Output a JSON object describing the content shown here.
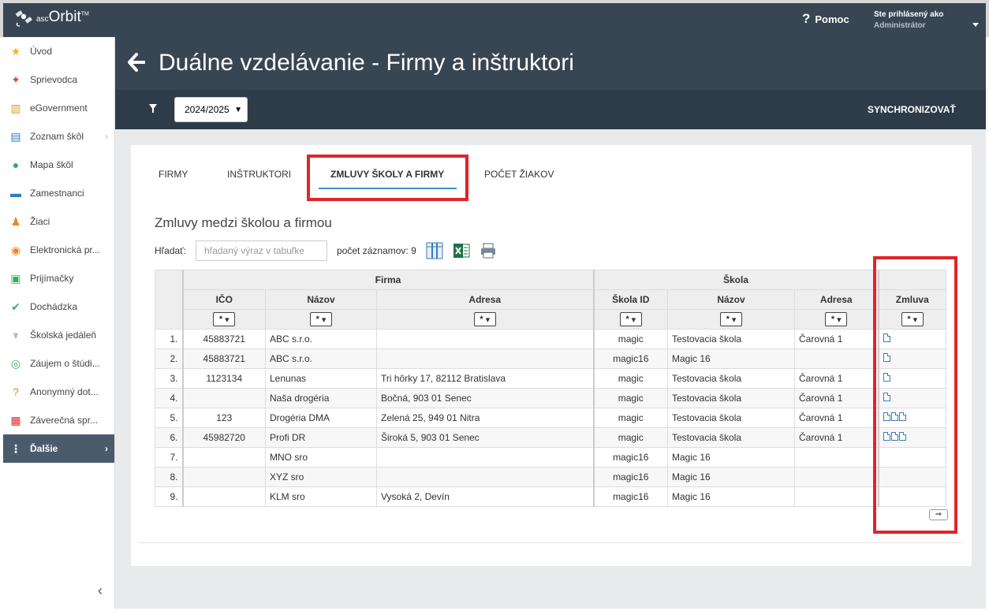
{
  "app": {
    "logo_text": "Orbit",
    "logo_small": "asc",
    "logo_tm": "TM",
    "help_label": "Pomoc",
    "user_line1": "Ste prihlásený ako",
    "user_line2": "Administrátor"
  },
  "sidebar": {
    "items": [
      {
        "label": "Úvod",
        "icon": "star-icon",
        "color": "#f2b41c"
      },
      {
        "label": "Sprievodca",
        "icon": "wand-icon",
        "color": "#e04a2a"
      },
      {
        "label": "eGovernment",
        "icon": "bank-icon",
        "color": "#d8a21c"
      },
      {
        "label": "Zoznam škôl",
        "icon": "book-icon",
        "color": "#2e7fc2"
      },
      {
        "label": "Mapa škôl",
        "icon": "map-pin-icon",
        "color": "#2fb05a"
      },
      {
        "label": "Zamestnanci",
        "icon": "briefcase-icon",
        "color": "#2e7fc2"
      },
      {
        "label": "Žiaci",
        "icon": "student-icon",
        "color": "#e8862a"
      },
      {
        "label": "Elektronická pr...",
        "icon": "application-icon",
        "color": "#e8862a"
      },
      {
        "label": "Prijímačky",
        "icon": "badge-icon",
        "color": "#2fb05a"
      },
      {
        "label": "Dochádzka",
        "icon": "check-circle-icon",
        "color": "#2fb08a"
      },
      {
        "label": "Školská jedáleň",
        "icon": "cup-icon",
        "color": "#7b3a8c"
      },
      {
        "label": "Záujem o štúdi...",
        "icon": "compass-icon",
        "color": "#2fb05a"
      },
      {
        "label": "Anonymný dot...",
        "icon": "question-icon",
        "color": "#e8862a"
      },
      {
        "label": "Záverečná spr...",
        "icon": "clipboard-icon",
        "color": "#e0242b"
      },
      {
        "label": "Ďalšie",
        "icon": "more-icon",
        "color": "#ffffff"
      }
    ]
  },
  "header": {
    "title": "Duálne vzdelávanie - Firmy a inštruktori",
    "year": "2024/2025",
    "sync_label": "SYNCHRONIZOVAŤ"
  },
  "tabs": [
    {
      "label": "FIRMY"
    },
    {
      "label": "INŠTRUKTORI"
    },
    {
      "label": "ZMLUVY ŠKOLY A FIRMY"
    },
    {
      "label": "POČET ŽIAKOV"
    }
  ],
  "content": {
    "section_title": "Zmluvy medzi školou a firmou",
    "search_label": "Hľadať:",
    "search_placeholder": "hľadaný výraz v tabuľke",
    "count_label": "počet záznamov: 9"
  },
  "table": {
    "group_firma": "Firma",
    "group_skola": "Škola",
    "columns": [
      "IČO",
      "Názov",
      "Adresa",
      "Škola ID",
      "Názov",
      "Adresa",
      "Zmluva"
    ],
    "filter_value": "*",
    "rows": [
      {
        "n": "1.",
        "ico": "45883721",
        "firma": "ABC s.r.o.",
        "adresa": "",
        "skola_id": "magic",
        "skola": "Testovacia škola",
        "skola_adresa": "Čarovná 1",
        "docs": 1
      },
      {
        "n": "2.",
        "ico": "45883721",
        "firma": "ABC s.r.o.",
        "adresa": "",
        "skola_id": "magic16",
        "skola": "Magic 16",
        "skola_adresa": "",
        "docs": 1
      },
      {
        "n": "3.",
        "ico": "1123134",
        "firma": "Lenunas",
        "adresa": "Tri hôrky 17, 82112 Bratislava",
        "skola_id": "magic",
        "skola": "Testovacia škola",
        "skola_adresa": "Čarovná 1",
        "docs": 1
      },
      {
        "n": "4.",
        "ico": "",
        "firma": "Naša drogéria",
        "adresa": "Bočná, 903 01 Senec",
        "skola_id": "magic",
        "skola": "Testovacia škola",
        "skola_adresa": "Čarovná 1",
        "docs": 1
      },
      {
        "n": "5.",
        "ico": "123",
        "firma": "Drogéria DMA",
        "adresa": "Zelená 25, 949 01 Nitra",
        "skola_id": "magic",
        "skola": "Testovacia škola",
        "skola_adresa": "Čarovná 1",
        "docs": 3
      },
      {
        "n": "6.",
        "ico": "45982720",
        "firma": "Profi DR",
        "adresa": "Široká 5, 903 01 Senec",
        "skola_id": "magic",
        "skola": "Testovacia škola",
        "skola_adresa": "Čarovná 1",
        "docs": 3
      },
      {
        "n": "7.",
        "ico": "",
        "firma": "MNO sro",
        "adresa": "",
        "skola_id": "magic16",
        "skola": "Magic 16",
        "skola_adresa": "",
        "docs": 0
      },
      {
        "n": "8.",
        "ico": "",
        "firma": "XYZ sro",
        "adresa": "",
        "skola_id": "magic16",
        "skola": "Magic 16",
        "skola_adresa": "",
        "docs": 0
      },
      {
        "n": "9.",
        "ico": "",
        "firma": "KLM sro",
        "adresa": "Vysoká 2, Devín",
        "skola_id": "magic16",
        "skola": "Magic 16",
        "skola_adresa": "",
        "docs": 0
      }
    ],
    "export_arrow": "⇒"
  },
  "colors": {
    "header_bg": "#384552",
    "toolbar_bg": "#2e3b48",
    "highlight": "#e0242b",
    "tab_underline": "#3b8fd1"
  }
}
